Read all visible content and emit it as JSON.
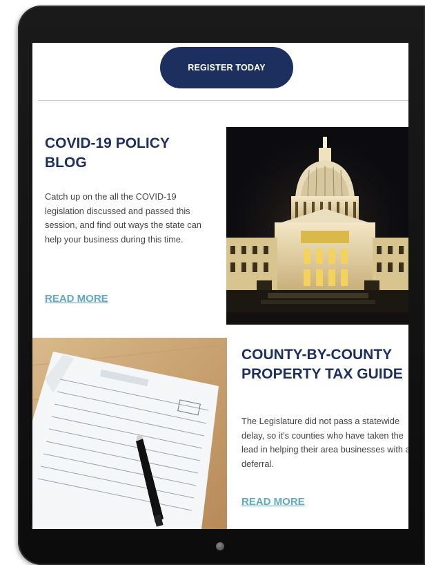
{
  "register": {
    "label": "REGISTER TODAY"
  },
  "card1": {
    "title": "COVID-19 POLICY BLOG",
    "text": "Catch up on the all the COVID-19 legislation discussed and passed this session, and find out ways the state can help your business during this time.",
    "link": "READ MORE",
    "image": "state-capitol-photo"
  },
  "card2": {
    "title": "COUNTY-BY-COUNTY PROPERTY TAX GUIDE",
    "text": "The Legislature did not pass a statewide delay, so it's counties who have taken the lead in helping their area businesses with a deferral.",
    "link": "READ MORE",
    "image": "tax-form-and-pen-photo"
  },
  "colors": {
    "navy": "#1c2f5e",
    "link": "#5fa8c8",
    "body_text": "#444444",
    "device": "#111111"
  },
  "icons": {
    "home_button": "home-button-icon"
  }
}
